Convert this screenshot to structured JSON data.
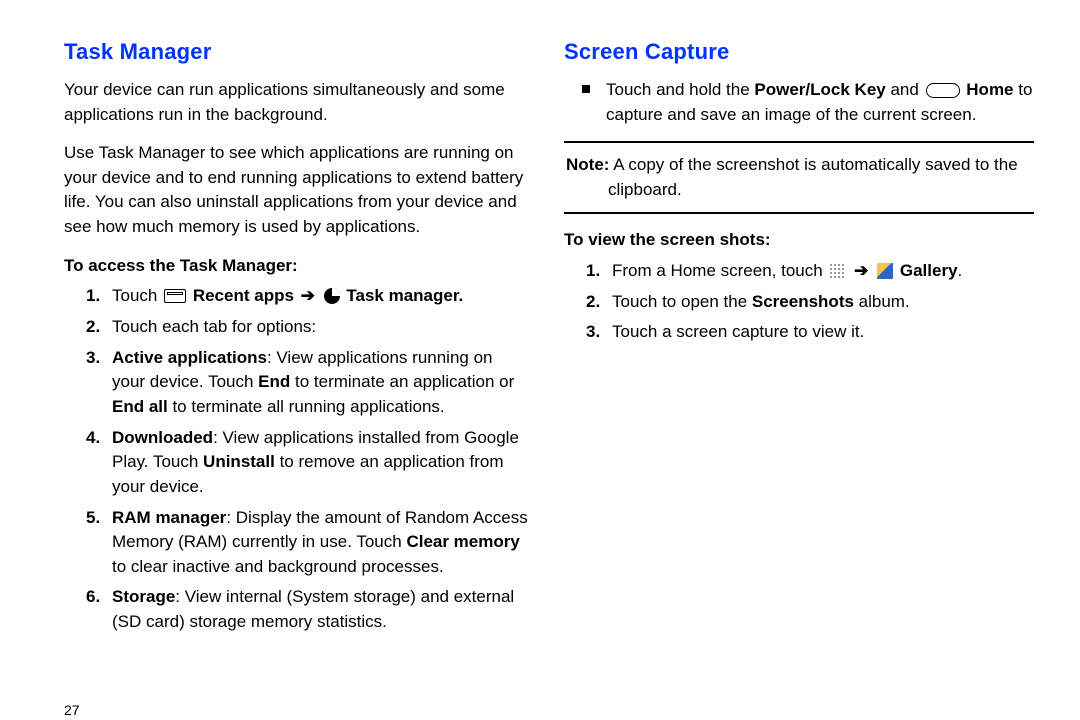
{
  "pageNumber": "27",
  "left": {
    "heading": "Task Manager",
    "intro1": "Your device can run applications simultaneously and some applications run in the background.",
    "intro2": "Use Task Manager to see which applications are running on your device and to end running applications to extend battery life. You can also uninstall applications from your device and see how much memory is used by applications.",
    "subhead": "To access the Task Manager:",
    "items": {
      "i1_pre": "Touch ",
      "i1_recent": "Recent apps",
      "i1_tm": "Task manager.",
      "i2": "Touch each tab for options:",
      "i3_b": "Active applications",
      "i3_rest": ": View applications running on your device. Touch ",
      "i3_end": "End",
      "i3_mid": " to terminate an application or ",
      "i3_endall": "End all",
      "i3_tail": " to terminate all running applications.",
      "i4_b": "Downloaded",
      "i4_rest": ": View applications installed from Google Play. Touch ",
      "i4_un": "Uninstall",
      "i4_tail": " to remove an application from your device.",
      "i5_b": "RAM manager",
      "i5_rest": ": Display the amount of Random Access Memory (RAM) currently in use. Touch ",
      "i5_cm": "Clear memory",
      "i5_tail": " to clear inactive and background processes.",
      "i6_b": "Storage",
      "i6_rest": ": View internal (System storage) and external (SD card) storage memory statistics."
    }
  },
  "right": {
    "heading": "Screen Capture",
    "bullet_pre": "Touch and hold the ",
    "bullet_key": "Power/Lock Key",
    "bullet_and": " and ",
    "bullet_home": "Home",
    "bullet_tail": " to capture and save an image of the current screen.",
    "note_label": "Note:",
    "note_line1": " A copy of the screenshot is automatically saved to the",
    "note_line2": "clipboard.",
    "subhead": "To view the screen shots:",
    "items": {
      "i1_pre": "From a Home screen, touch ",
      "i1_gal": "Gallery",
      "i2_pre": "Touch to open the ",
      "i2_b": "Screenshots",
      "i2_tail": " album.",
      "i3": "Touch a screen capture to view it."
    }
  }
}
